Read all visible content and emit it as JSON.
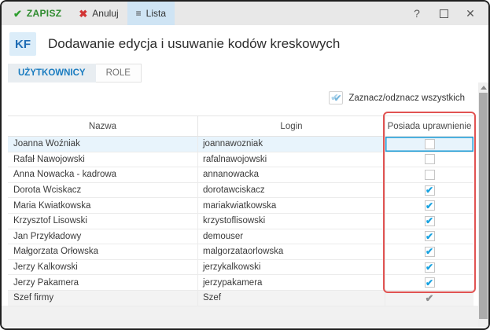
{
  "toolbar": {
    "save_label": "ZAPISZ",
    "save_icon": "✔",
    "cancel_label": "Anuluj",
    "cancel_icon": "✖",
    "list_label": "Lista",
    "list_icon": "≡",
    "help_icon": "?",
    "close_icon": "✕"
  },
  "header": {
    "badge": "KF",
    "title": "Dodawanie edycja i usuwanie kodów kreskowych"
  },
  "tabs": [
    {
      "label": "UŻYTKOWNICY",
      "active": true
    },
    {
      "label": "ROLE",
      "active": false
    }
  ],
  "toggle_all": {
    "label": "Zaznacz/odznacz wszystkich",
    "icon": "double-check"
  },
  "table": {
    "columns": [
      "Nazwa",
      "Login",
      "Posiada uprawnienie"
    ],
    "check_glyph": "✔",
    "rows": [
      {
        "name": "Joanna Woźniak",
        "login": "joannawozniak",
        "permission": "unchecked",
        "selected": true
      },
      {
        "name": "Rafał Nawojowski",
        "login": "rafalnawojowski",
        "permission": "unchecked",
        "selected": false
      },
      {
        "name": "Anna Nowacka - kadrowa",
        "login": "annanowacka",
        "permission": "unchecked",
        "selected": false
      },
      {
        "name": "Dorota Wciskacz",
        "login": "dorotawciskacz",
        "permission": "checked",
        "selected": false
      },
      {
        "name": "Maria Kwiatkowska",
        "login": "mariakwiatkowska",
        "permission": "checked",
        "selected": false
      },
      {
        "name": "Krzysztof Lisowski",
        "login": "krzystoflisowski",
        "permission": "checked",
        "selected": false
      },
      {
        "name": "Jan Przykładowy",
        "login": "demouser",
        "permission": "checked",
        "selected": false
      },
      {
        "name": "Małgorzata Orłowska",
        "login": "malgorzataorlowska",
        "permission": "checked",
        "selected": false
      },
      {
        "name": "Jerzy Kalkowski",
        "login": "jerzykalkowski",
        "permission": "checked",
        "selected": false
      },
      {
        "name": "Jerzy Pakamera",
        "login": "jerzypakamera",
        "permission": "checked",
        "selected": false
      },
      {
        "name": "Szef firmy",
        "login": "Szef",
        "permission": "granted-readonly",
        "selected": false
      }
    ]
  },
  "colors": {
    "save_green": "#2e8b2e",
    "cancel_red": "#d23535",
    "accent_blue": "#1a7cc0",
    "check_blue": "#18a2e0",
    "annotation_red": "#e15352",
    "selected_row": "#e8f4fc",
    "list_button_bg": "#cfe4f4"
  }
}
